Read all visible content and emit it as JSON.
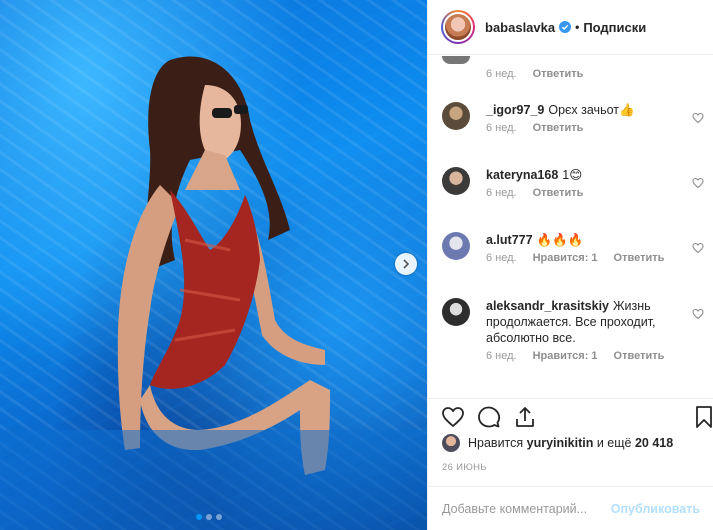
{
  "post": {
    "author": "babaslavka",
    "follow_label": "Подписки",
    "separator": "•",
    "carousel": {
      "count": 3,
      "active_index": 0
    },
    "comments": [
      {
        "author": "",
        "text": "",
        "time": "6 нед.",
        "likes": "",
        "reply": "Ответить"
      },
      {
        "author": "_igor97_9",
        "text": "Орєх зачьот👍",
        "time": "6 нед.",
        "likes": "",
        "reply": "Ответить"
      },
      {
        "author": "kateryna168",
        "text": "1😊",
        "time": "6 нед.",
        "likes": "",
        "reply": "Ответить"
      },
      {
        "author": "a.lut777",
        "text": "🔥🔥🔥",
        "time": "6 нед.",
        "likes": "Нравится: 1",
        "reply": "Ответить"
      },
      {
        "author": "aleksandr_krasitskiy",
        "text": "Жизнь продолжается. Все проходит, абсолютно все.",
        "time": "6 нед.",
        "likes": "Нравится: 1",
        "reply": "Ответить"
      }
    ],
    "likes_prefix": "Нравится",
    "liked_by": "yuryinikitin",
    "likes_suffix": "и ещё",
    "likes_count": "20 418",
    "date": "26 ИЮНЬ",
    "comment_placeholder": "Добавьте комментарий...",
    "publish_label": "Опубликовать"
  },
  "icons": {
    "verified": "verified-badge-icon",
    "heart": "heart-icon",
    "comment": "comment-icon",
    "share": "share-icon",
    "save": "bookmark-icon",
    "next": "chevron-right-icon"
  },
  "colors": {
    "accent": "#0095f6",
    "publish_disabled": "#b2dffc",
    "muted": "#999999"
  }
}
